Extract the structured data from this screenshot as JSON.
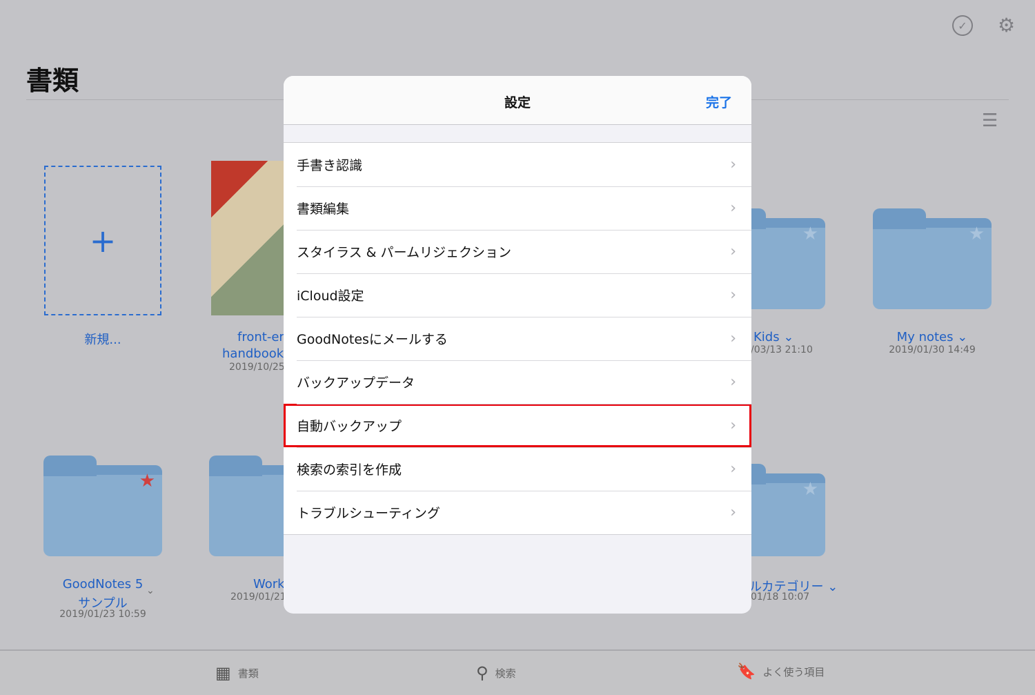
{
  "header": {
    "title": "書類"
  },
  "top_icons": [
    "select-check-icon",
    "gear-icon",
    "list-view-icon"
  ],
  "documents": {
    "new": {
      "label": "新規..."
    },
    "front_end": {
      "line1": "front-er",
      "line2": "handbook-",
      "date": "2019/10/25"
    },
    "kids": {
      "label": "Kids",
      "date": "/03/13 21:10"
    },
    "my_notes": {
      "label": "My notes",
      "date": "2019/01/30 14:49"
    },
    "goodnotes": {
      "line1": "GoodNotes 5",
      "line2": "サンプル",
      "date": "2019/01/23 10:59"
    },
    "work": {
      "label": "Work",
      "date": "2019/01/21"
    },
    "category": {
      "label": "ルカテゴリー",
      "date": "01/18 10:07"
    }
  },
  "colors": {
    "accent": "#1a73e8",
    "highlight": "#e8000b",
    "favorite_star": "#d0413f"
  },
  "modal": {
    "title": "設定",
    "done": "完了",
    "items": [
      "手書き認識",
      "書類編集",
      "スタイラス & パームリジェクション",
      "iCloud設定",
      "GoodNotesにメールする",
      "バックアップデータ",
      "自動バックアップ",
      "検索の索引を作成",
      "トラブルシューティング"
    ],
    "highlighted_item": "自動バックアップ"
  },
  "tabbar": {
    "documents": "書類",
    "search": "検索",
    "favorites": "よく使う項目"
  }
}
